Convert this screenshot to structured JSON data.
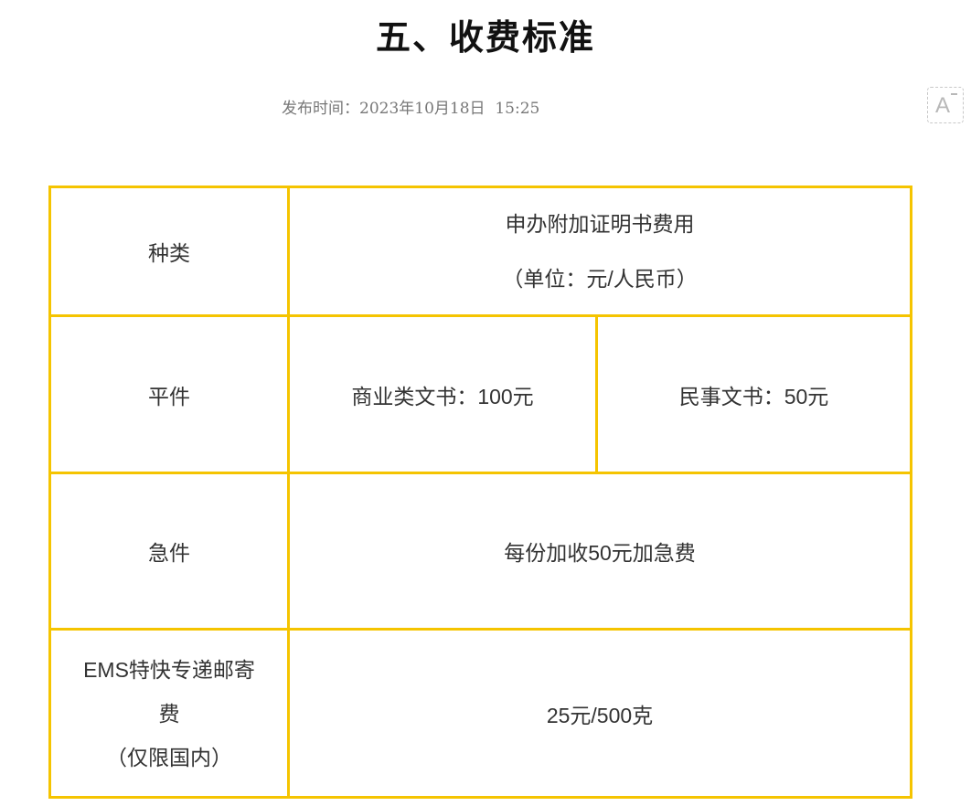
{
  "title": "五、收费标准",
  "meta": {
    "published_label": "发布时间：",
    "published_value": "2023年10月18日  15:25"
  },
  "toolbar": {
    "font_size_label": "A"
  },
  "table": {
    "header": {
      "category": "种类",
      "fee_title": "申办附加证明书费用",
      "fee_unit": "（单位：元/人民币）"
    },
    "regular": {
      "label": "平件",
      "commercial": "商业类文书：100元",
      "civil": "民事文书：50元"
    },
    "urgent": {
      "label": "急件",
      "fee": "每份加收50元加急费"
    },
    "ems": {
      "label_line1": "EMS特快专递邮寄",
      "label_line2": "费",
      "label_line3": "（仅限国内）",
      "fee": "25元/500克"
    }
  },
  "colors": {
    "table_border": "#f5c400"
  }
}
